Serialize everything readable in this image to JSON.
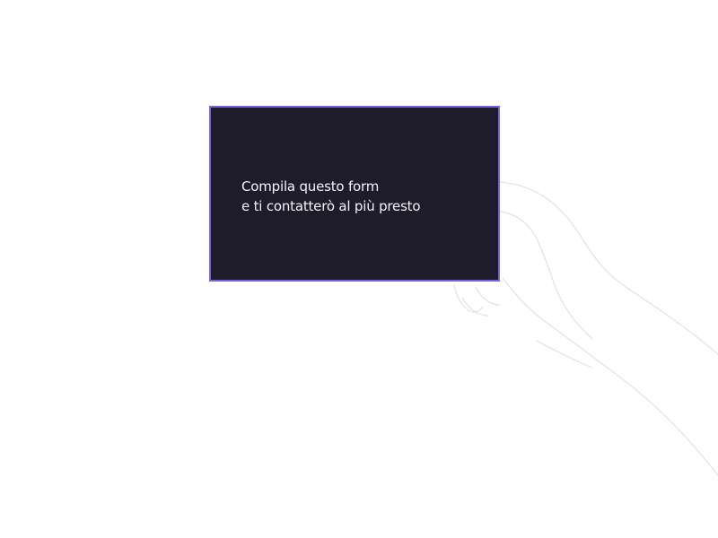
{
  "card": {
    "line1": "Compila questo form",
    "line2": "e ti contatterò al più presto"
  },
  "colors": {
    "card_background": "#1e1b2b",
    "card_border": "#7b64d9",
    "card_text": "#f4f3f8",
    "hand_outline": "#dcdce0"
  },
  "icons": {
    "hand": "hand-holding-card-illustration"
  }
}
